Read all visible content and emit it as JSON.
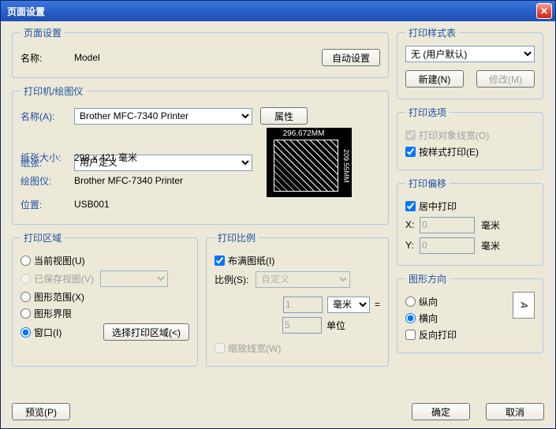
{
  "title": "页面设置",
  "pageSetup": {
    "legend": "页面设置",
    "nameLabel": "名称:",
    "nameValue": "Model",
    "autoBtn": "自动设置"
  },
  "printer": {
    "legend": "打印机/绘图仪",
    "nameLabel": "名称(A):",
    "nameValue": "Brother MFC-7340 Printer",
    "propBtn": "属性",
    "paperLabel": "纸张:",
    "paperValue": "用户定义",
    "sizeLabel": "纸张大小:",
    "sizeValue": "298 x 421 毫米",
    "plotterLabel": "绘图仪:",
    "plotterValue": "Brother MFC-7340 Printer",
    "locLabel": "位置:",
    "locValue": "USB001",
    "preview": {
      "w": "296.672MM",
      "h": "209.55MM"
    }
  },
  "area": {
    "legend": "打印区域",
    "current": "当前视图(U)",
    "saved": "已保存视图(V)",
    "extent": "图形范围(X)",
    "limits": "图形界限",
    "window": "窗口(I)",
    "chooseBtn": "选择打印区域(<)"
  },
  "scale": {
    "legend": "打印比例",
    "fit": "布满图纸(I)",
    "ratioLabel": "比例(S):",
    "ratioValue": "自定义",
    "val1": "1",
    "unit1": "毫米",
    "eq": "=",
    "val2": "5",
    "unit2": "单位",
    "zoomLine": "缩放线宽(W)"
  },
  "styleTable": {
    "legend": "打印样式表",
    "value": "无 (用户默认)",
    "newBtn": "新建(N)",
    "modifyBtn": "修改(M)"
  },
  "options": {
    "legend": "打印选项",
    "lineweight": "打印对象线宽(O)",
    "byStyle": "按样式打印(E)"
  },
  "offset": {
    "legend": "打印偏移",
    "center": "居中打印",
    "xLabel": "X:",
    "xVal": "0",
    "xUnit": "毫米",
    "yLabel": "Y:",
    "yVal": "0",
    "yUnit": "毫米"
  },
  "orient": {
    "legend": "图形方向",
    "portrait": "纵向",
    "landscape": "横向",
    "reverse": "反向打印",
    "glyph": "A"
  },
  "buttons": {
    "preview": "预览(P)",
    "ok": "确定",
    "cancel": "取消"
  }
}
